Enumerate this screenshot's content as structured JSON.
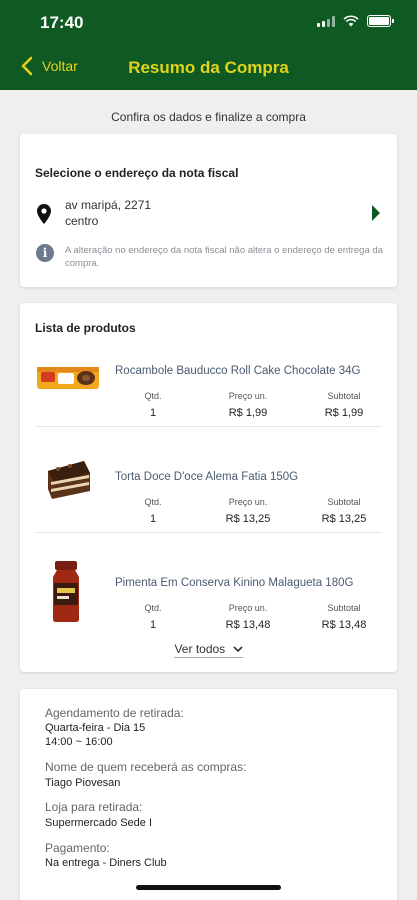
{
  "status_bar": {
    "time": "17:40"
  },
  "header": {
    "back_label": "Voltar",
    "title": "Resumo da Compra"
  },
  "subtitle": "Confira os dados e finalize a compra",
  "address_card": {
    "title": "Selecione o endereço da nota fiscal",
    "address_line1": "av maripá, 2271",
    "address_line2": "centro",
    "info_text": "A alteração no endereço da nota fiscal não altera o endereço de entrega da compra."
  },
  "products_card": {
    "title": "Lista de produtos",
    "labels": {
      "qty": "Qtd.",
      "price": "Preço un.",
      "subtotal": "Subtotal"
    },
    "items": [
      {
        "name": "Rocambole Bauducco Roll Cake Chocolate 34G",
        "qty": "1",
        "price": "R$ 1,99",
        "subtotal": "R$ 1,99"
      },
      {
        "name": "Torta Doce D'oce Alema Fatia 150G",
        "qty": "1",
        "price": "R$ 13,25",
        "subtotal": "R$ 13,25"
      },
      {
        "name": "Pimenta Em Conserva Kinino Malagueta 180G",
        "qty": "1",
        "price": "R$ 13,48",
        "subtotal": "R$ 13,48"
      }
    ],
    "see_all": "Ver todos"
  },
  "schedule_card": {
    "pickup_label": "Agendamento de retirada:",
    "pickup_day": "Quarta-feira - Dia 15",
    "pickup_time": "14:00 ~ 16:00",
    "receiver_label": "Nome de quem receberá as compras:",
    "receiver_name": "Tiago Piovesan",
    "store_label": "Loja para retirada:",
    "store_name": "Supermercado Sede I",
    "payment_label": "Pagamento:",
    "payment_value": "Na entrega - Diners Club"
  },
  "colors": {
    "header_bg": "#0f5a23",
    "header_accent": "#e3d21b",
    "product_name": "#4a5b72"
  },
  "icons": [
    "back-chevron-icon",
    "location-pin-icon",
    "chevron-right-icon",
    "info-icon",
    "chevron-down-icon"
  ]
}
